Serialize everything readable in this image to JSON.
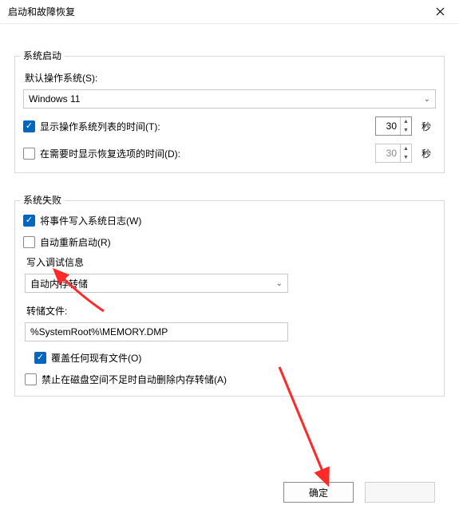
{
  "window": {
    "title": "启动和故障恢复"
  },
  "startup": {
    "group_title": "系统启动",
    "default_os_label": "默认操作系统(S):",
    "default_os_value": "Windows 11",
    "show_os_list_label": "显示操作系统列表的时间(T):",
    "show_os_list_checked": true,
    "show_os_list_seconds": "30",
    "show_recovery_label": "在需要时显示恢复选项的时间(D):",
    "show_recovery_checked": false,
    "show_recovery_seconds": "30",
    "seconds_unit": "秒"
  },
  "failure": {
    "group_title": "系统失败",
    "write_event_label": "将事件写入系统日志(W)",
    "write_event_checked": true,
    "auto_restart_label": "自动重新启动(R)",
    "auto_restart_checked": false,
    "debug_info_label": "写入调试信息",
    "debug_type_value": "自动内存转储",
    "dump_file_label": "转储文件:",
    "dump_file_value": "%SystemRoot%\\MEMORY.DMP",
    "overwrite_label": "覆盖任何现有文件(O)",
    "overwrite_checked": true,
    "disable_auto_delete_label": "禁止在磁盘空间不足时自动删除内存转储(A)",
    "disable_auto_delete_checked": false
  },
  "buttons": {
    "ok": "确定",
    "cancel": ""
  },
  "annotations": {
    "arrow_color": "#ff2a2a"
  }
}
